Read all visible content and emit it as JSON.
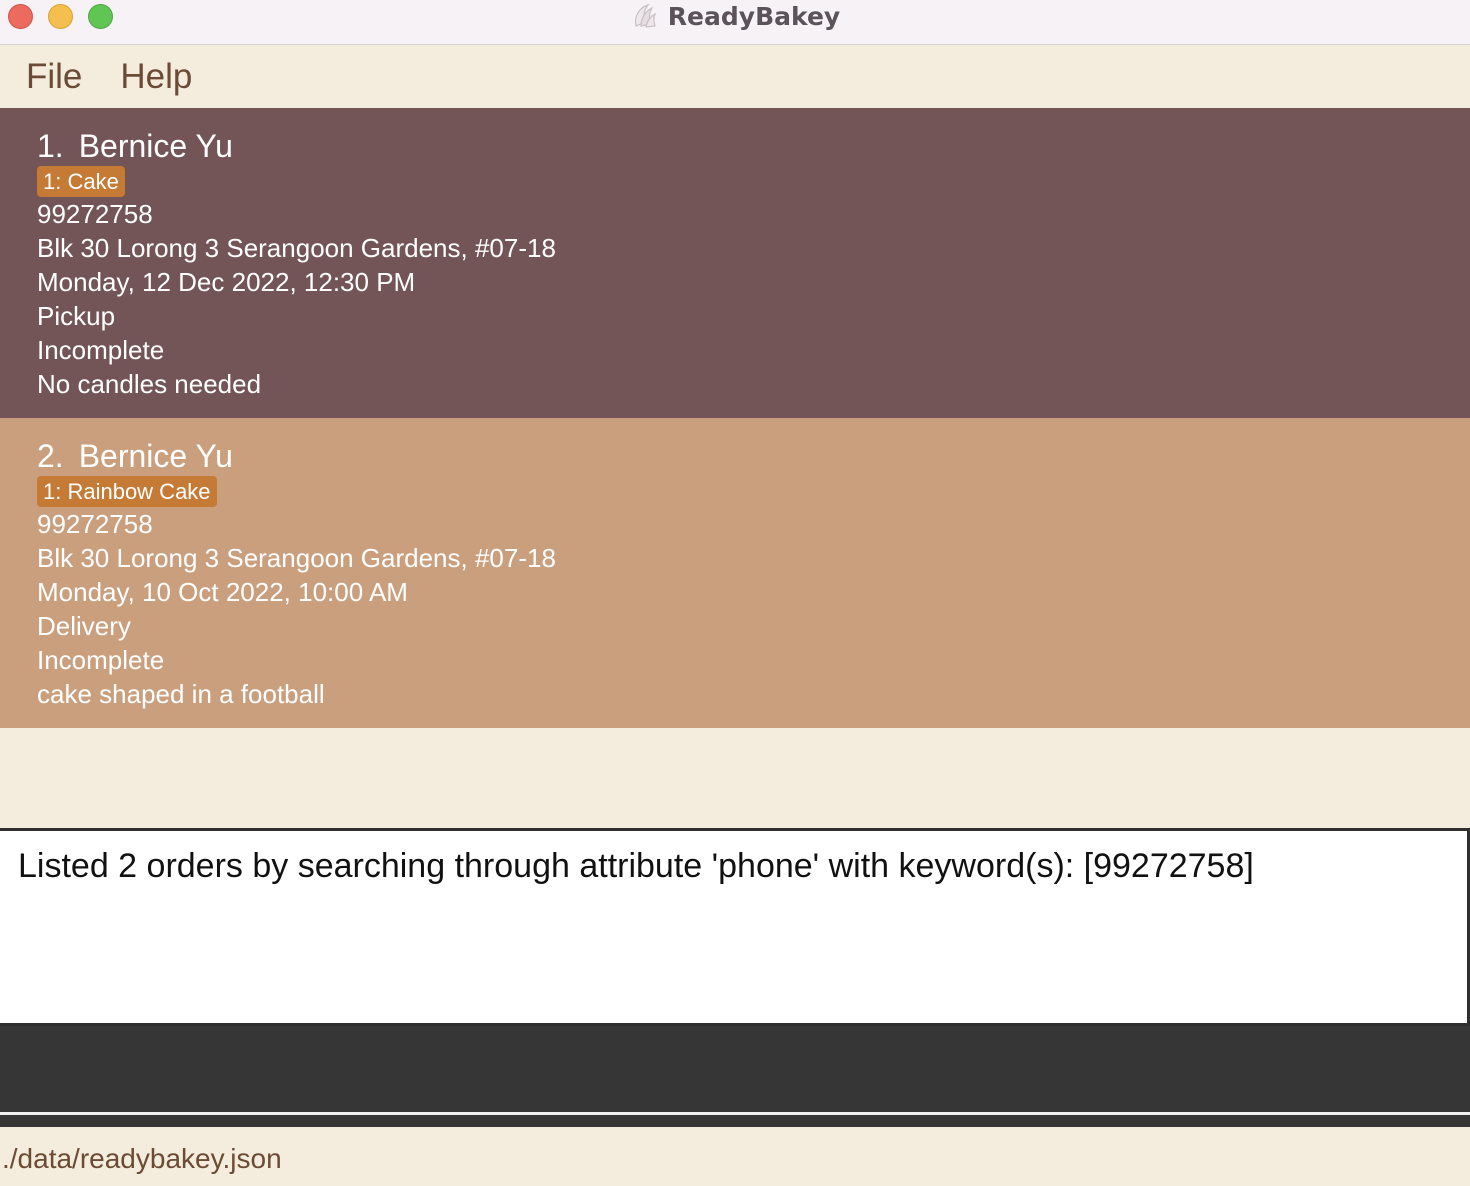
{
  "window": {
    "title": "ReadyBakey"
  },
  "menu": {
    "items": [
      {
        "label": "File"
      },
      {
        "label": "Help"
      }
    ]
  },
  "orders": [
    {
      "index": "1.",
      "name": "Bernice Yu",
      "tag": "1: Cake",
      "phone": "99272758",
      "address": "Blk 30 Lorong 3 Serangoon Gardens, #07-18",
      "deadline": "Monday, 12 Dec 2022, 12:30 PM",
      "method": "Pickup",
      "status": "Incomplete",
      "remark": "No candles needed"
    },
    {
      "index": "2.",
      "name": "Bernice Yu",
      "tag": "1: Rainbow Cake",
      "phone": "99272758",
      "address": "Blk 30 Lorong 3 Serangoon Gardens, #07-18",
      "deadline": "Monday, 10 Oct 2022, 10:00 AM",
      "method": "Delivery",
      "status": "Incomplete",
      "remark": "cake shaped in a football"
    }
  ],
  "result": {
    "message": "Listed 2 orders by searching through attribute 'phone' with keyword(s): [99272758]"
  },
  "command": {
    "value": ""
  },
  "status_bar": {
    "path": "./data/readybakey.json"
  },
  "colors": {
    "card_selected": "#735557",
    "card_normal": "#c99f7d",
    "tag": "#c57a35",
    "background": "#f4ecdc",
    "command_bg": "#363636"
  }
}
